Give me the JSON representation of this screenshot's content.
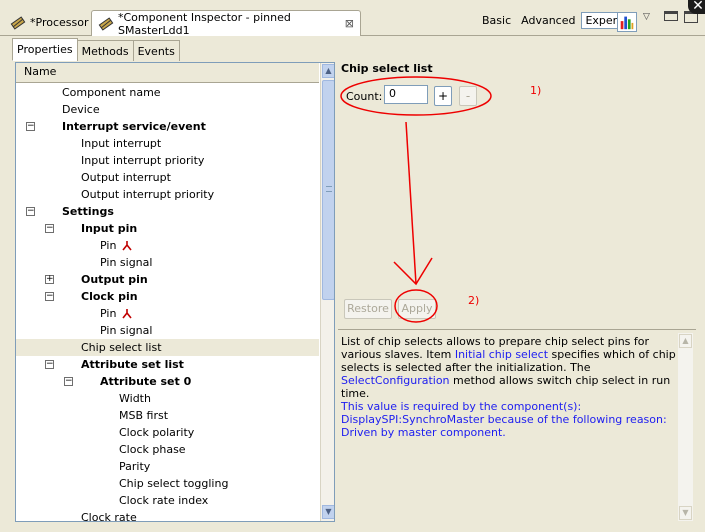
{
  "editor_tabs": [
    {
      "label": "*Processor"
    },
    {
      "label": "*Component Inspector - pinned SMasterLdd1",
      "close": "⊠"
    }
  ],
  "modes": {
    "basic": "Basic",
    "advanced": "Advanced",
    "expert": "Expert"
  },
  "sub_tabs": [
    "Properties",
    "Methods",
    "Events"
  ],
  "tree": {
    "header": "Name",
    "rows": [
      {
        "label": "Component name",
        "indent": 0,
        "bold": false,
        "expander": ""
      },
      {
        "label": "Device",
        "indent": 0,
        "bold": false,
        "expander": ""
      },
      {
        "label": "Interrupt service/event",
        "indent": 0,
        "bold": true,
        "expander": "−"
      },
      {
        "label": "Input interrupt",
        "indent": 1,
        "bold": false,
        "expander": ""
      },
      {
        "label": "Input interrupt priority",
        "indent": 1,
        "bold": false,
        "expander": ""
      },
      {
        "label": "Output interrupt",
        "indent": 1,
        "bold": false,
        "expander": ""
      },
      {
        "label": "Output interrupt priority",
        "indent": 1,
        "bold": false,
        "expander": ""
      },
      {
        "label": "Settings",
        "indent": 0,
        "bold": true,
        "expander": "−"
      },
      {
        "label": "Input pin",
        "indent": 1,
        "bold": true,
        "expander": "−"
      },
      {
        "label": "Pin",
        "indent": 2,
        "bold": false,
        "expander": "",
        "pin": true
      },
      {
        "label": "Pin signal",
        "indent": 2,
        "bold": false,
        "expander": ""
      },
      {
        "label": "Output pin",
        "indent": 1,
        "bold": true,
        "expander": "+"
      },
      {
        "label": "Clock pin",
        "indent": 1,
        "bold": true,
        "expander": "−"
      },
      {
        "label": "Pin",
        "indent": 2,
        "bold": false,
        "expander": "",
        "pin": true
      },
      {
        "label": "Pin signal",
        "indent": 2,
        "bold": false,
        "expander": ""
      },
      {
        "label": "Chip select list",
        "indent": 1,
        "bold": false,
        "expander": "",
        "selected": true
      },
      {
        "label": "Attribute set list",
        "indent": 1,
        "bold": true,
        "expander": "−"
      },
      {
        "label": "Attribute set 0",
        "indent": 2,
        "bold": true,
        "expander": "−"
      },
      {
        "label": "Width",
        "indent": 3,
        "bold": false,
        "expander": ""
      },
      {
        "label": "MSB first",
        "indent": 3,
        "bold": false,
        "expander": ""
      },
      {
        "label": "Clock polarity",
        "indent": 3,
        "bold": false,
        "expander": ""
      },
      {
        "label": "Clock phase",
        "indent": 3,
        "bold": false,
        "expander": ""
      },
      {
        "label": "Parity",
        "indent": 3,
        "bold": false,
        "expander": ""
      },
      {
        "label": "Chip select toggling",
        "indent": 3,
        "bold": false,
        "expander": ""
      },
      {
        "label": "Clock rate index",
        "indent": 3,
        "bold": false,
        "expander": ""
      },
      {
        "label": "Clock rate",
        "indent": 1,
        "bold": false,
        "expander": ""
      }
    ]
  },
  "detail": {
    "title": "Chip select list",
    "count_label": "Count:",
    "count_value": "0",
    "plus": "+",
    "minus": "-",
    "restore": "Restore",
    "apply": "Apply",
    "annotation_1": "1)",
    "annotation_2": "2)"
  },
  "description": {
    "p1": "List of chip selects allows to prepare chip select pins for various slaves. Item ",
    "link1": "Initial chip select",
    "p2": " specifies which of chip selects is selected after the initialization. The ",
    "link2": "SelectConfiguration",
    "p3": " method allows switch chip select in run time.",
    "p4": "This value is required by the component(s): DisplaySPI:SynchroMaster because of the following reason: Driven by master component."
  },
  "colors": {
    "annotation": "#e00000",
    "link": "#1d1df0",
    "panel": "#ece9d8"
  }
}
